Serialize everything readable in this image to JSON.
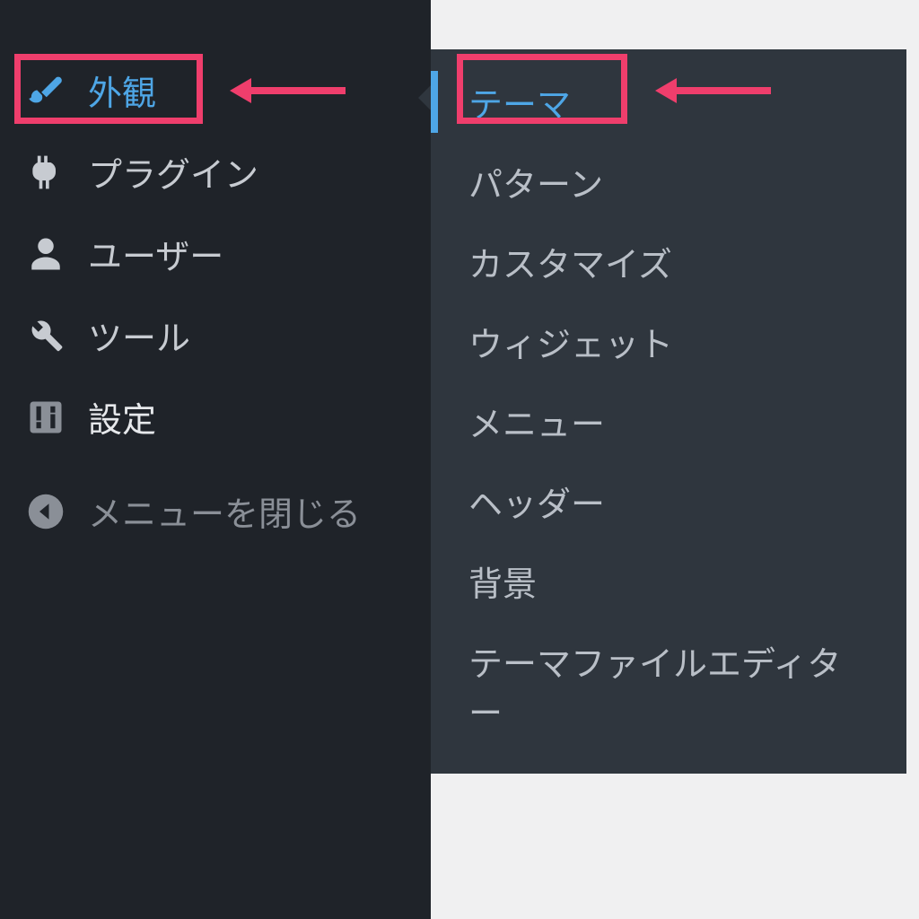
{
  "sidebar": {
    "items": [
      {
        "label": "外観",
        "icon": "brush-icon",
        "active": true
      },
      {
        "label": "プラグイン",
        "icon": "plug-icon",
        "active": false
      },
      {
        "label": "ユーザー",
        "icon": "user-icon",
        "active": false
      },
      {
        "label": "ツール",
        "icon": "wrench-icon",
        "active": false
      },
      {
        "label": "設定",
        "icon": "sliders-icon",
        "active": false
      }
    ],
    "collapse_label": "メニューを閉じる"
  },
  "submenu": {
    "items": [
      {
        "label": "テーマ",
        "active": true
      },
      {
        "label": "パターン",
        "active": false
      },
      {
        "label": "カスタマイズ",
        "active": false
      },
      {
        "label": "ウィジェット",
        "active": false
      },
      {
        "label": "メニュー",
        "active": false
      },
      {
        "label": "ヘッダー",
        "active": false
      },
      {
        "label": "背景",
        "active": false
      },
      {
        "label": "テーマファイルエディター",
        "active": false
      }
    ]
  },
  "annotations": {
    "highlight_color": "#ef3e6c",
    "accent_color": "#4ea6e6"
  }
}
